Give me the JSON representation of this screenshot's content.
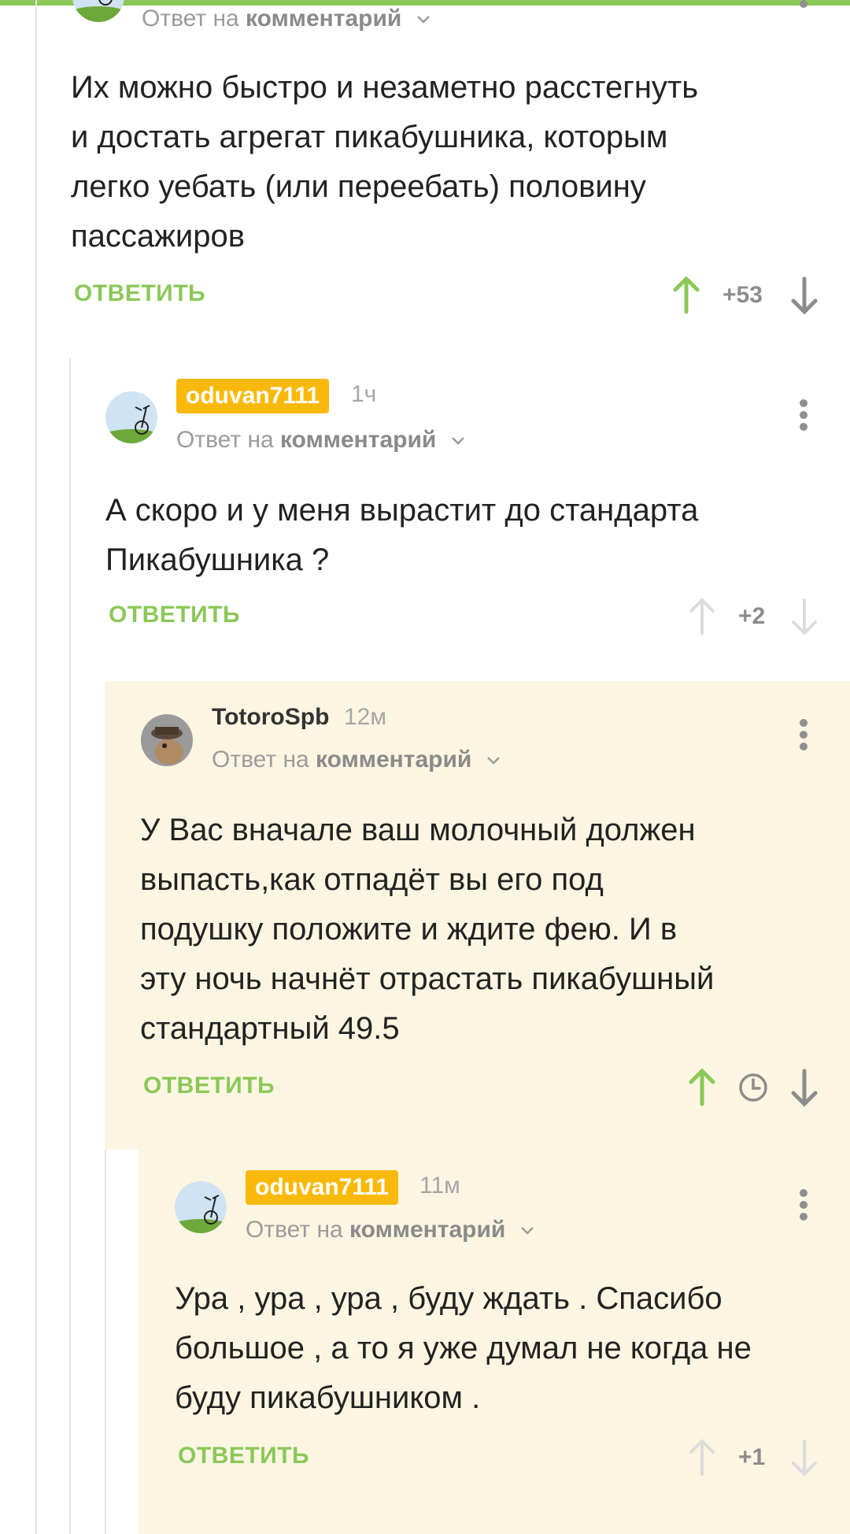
{
  "comments": [
    {
      "reply_to_prefix": "Ответ на",
      "reply_to_link": "комментарий",
      "text_lines": [
        "Их можно быстро и незаметно расстегнуть",
        "и достать агрегат пикабушника, которым",
        "легко уебать (или переебать) половину",
        "пассажиров"
      ],
      "reply_label": "ОТВЕТИТЬ",
      "rating": "+53",
      "upvoted": true
    },
    {
      "author": "oduvan7111",
      "time": "1ч",
      "reply_to_prefix": "Ответ на",
      "reply_to_link": "комментарий",
      "text_lines": [
        "А скоро и у меня вырастит до стандарта",
        "Пикабушника ?"
      ],
      "reply_label": "ОТВЕТИТЬ",
      "rating": "+2",
      "upvoted": false
    },
    {
      "author": "TotoroSpb",
      "time": "12м",
      "reply_to_prefix": "Ответ на",
      "reply_to_link": "комментарий",
      "text_lines": [
        "У Вас вначале ваш молочный должен",
        "выпасть,как отпадёт вы его под",
        "подушку положите и ждите фею. И в",
        "эту ночь начнёт отрастать пикабушный",
        "стандартный 49.5"
      ],
      "reply_label": "ОТВЕТИТЬ",
      "rating_hidden_icon": "clock-icon",
      "upvoted": true
    },
    {
      "author": "oduvan7111",
      "time": "11м",
      "reply_to_prefix": "Ответ на",
      "reply_to_link": "комментарий",
      "text_lines": [
        "Ура , ура , ура , буду ждать . Спасибо",
        "большое , а то я уже думал не когда не",
        "буду пикабушником ."
      ],
      "reply_label": "ОТВЕТИТЬ",
      "rating": "+1",
      "upvoted": false
    }
  ],
  "colors": {
    "accent_green": "#8ac858",
    "author_badge": "#f9b90a",
    "highlight_bg": "#fcf5e2",
    "muted": "#9b9b9b"
  }
}
